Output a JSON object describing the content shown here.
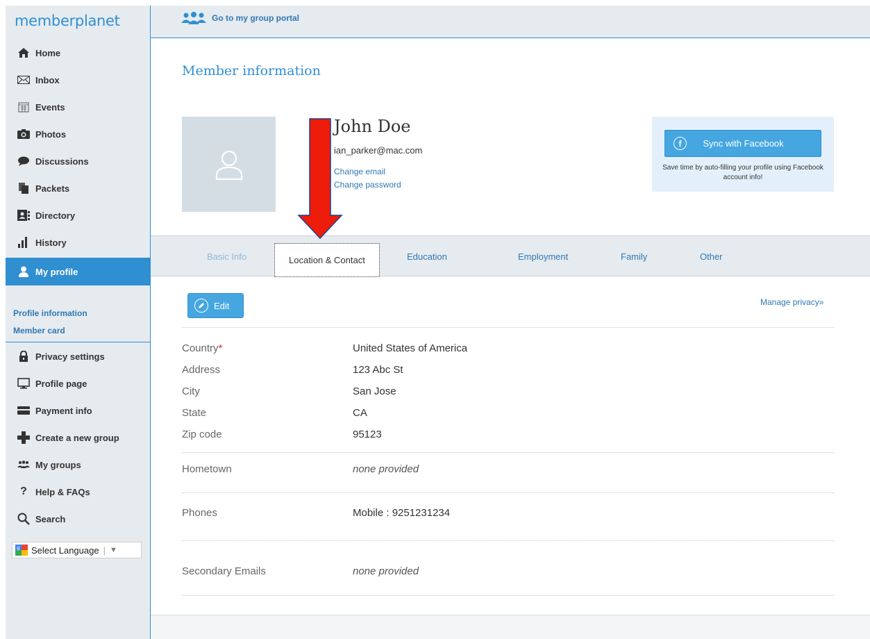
{
  "brand": {
    "logo_text": "memberplanet"
  },
  "sidebar": {
    "items": [
      {
        "label": "Home",
        "icon": "home-icon"
      },
      {
        "label": "Inbox",
        "icon": "envelope-icon"
      },
      {
        "label": "Events",
        "icon": "calendar-icon"
      },
      {
        "label": "Photos",
        "icon": "camera-icon"
      },
      {
        "label": "Discussions",
        "icon": "speech-bubble-icon"
      },
      {
        "label": "Packets",
        "icon": "documents-icon"
      },
      {
        "label": "Directory",
        "icon": "contact-card-icon"
      },
      {
        "label": "History",
        "icon": "bar-chart-icon"
      },
      {
        "label": "My profile",
        "icon": "person-icon",
        "active": true
      }
    ],
    "sub_links": [
      "Profile information",
      "Member card"
    ],
    "secondary_items": [
      {
        "label": "Privacy settings",
        "icon": "lock-icon"
      },
      {
        "label": "Profile page",
        "icon": "monitor-icon"
      },
      {
        "label": "Payment info",
        "icon": "credit-card-icon"
      },
      {
        "label": "Create a new group",
        "icon": "plus-icon"
      },
      {
        "label": "My groups",
        "icon": "group-icon"
      },
      {
        "label": "Help & FAQs",
        "icon": "question-icon"
      },
      {
        "label": "Search",
        "icon": "search-icon"
      }
    ],
    "language": {
      "label": "Select Language",
      "arrow": "▼"
    }
  },
  "topbar": {
    "portal_label": "Go to my group portal"
  },
  "main": {
    "title": "Member information",
    "user": {
      "name": "John Doe",
      "email": "ian_parker@mac.com",
      "change_email": "Change email",
      "change_password": "Change password"
    },
    "facebook": {
      "button_label": "Sync with Facebook",
      "note": "Save time by auto-filling your profile using Facebook account info!"
    },
    "tabs": [
      {
        "label": "Basic Info",
        "state": "muted"
      },
      {
        "label": "Location & Contact",
        "state": "active"
      },
      {
        "label": "Education",
        "state": "normal"
      },
      {
        "label": "Employment",
        "state": "normal"
      },
      {
        "label": "Family",
        "state": "normal"
      },
      {
        "label": "Other",
        "state": "normal"
      }
    ],
    "edit_label": "Edit",
    "manage_privacy": "Manage privacy»",
    "fields": {
      "country": {
        "label": "Country",
        "required_mark": "*",
        "value": "United States of America"
      },
      "address": {
        "label": "Address",
        "value": "123 Abc St"
      },
      "city": {
        "label": "City",
        "value": "San Jose"
      },
      "state": {
        "label": "State",
        "value": "CA"
      },
      "zip": {
        "label": "Zip code",
        "value": "95123"
      },
      "hometown": {
        "label": "Hometown",
        "value": "none provided"
      },
      "phones": {
        "label": "Phones",
        "value": "Mobile : 9251231234"
      },
      "secondary_emails": {
        "label": "Secondary Emails",
        "value": "none provided"
      }
    }
  },
  "colors": {
    "accent": "#2f8fd1",
    "link": "#2f78b5",
    "button": "#45a6e0",
    "sidebar_bg": "#e6ebef",
    "annotation_arrow": "#ee1c0a"
  }
}
